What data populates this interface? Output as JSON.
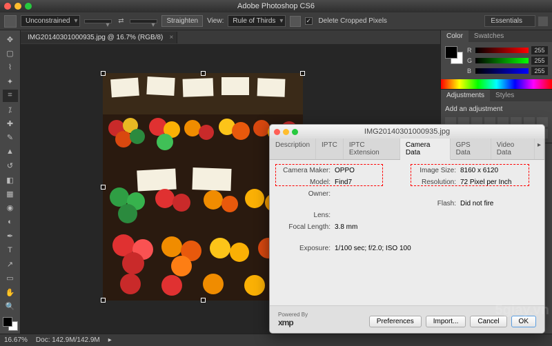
{
  "app_title": "Adobe Photoshop CS6",
  "workspace": "Essentials",
  "options_bar": {
    "ratio_mode": "Unconstrained",
    "straighten": "Straighten",
    "view_label": "View:",
    "overlay": "Rule of Thirds",
    "delete_cropped": "Delete Cropped Pixels"
  },
  "document": {
    "tab": "IMG20140301000935.jpg @ 16.7% (RGB/8)"
  },
  "panels": {
    "color_tab": "Color",
    "swatches_tab": "Swatches",
    "r": "255",
    "g": "255",
    "b": "255",
    "adjustments_tab": "Adjustments",
    "styles_tab": "Styles",
    "add_adjustment": "Add an adjustment"
  },
  "status": {
    "zoom": "16.67%",
    "doc": "Doc: 142.9M/142.9M"
  },
  "dialog": {
    "title": "IMG20140301000935.jpg",
    "tabs": {
      "description": "Description",
      "iptc": "IPTC",
      "iptc_ext": "IPTC Extension",
      "camera": "Camera Data",
      "gps": "GPS Data",
      "video": "Video Data"
    },
    "fields": {
      "camera_maker_k": "Camera Maker:",
      "camera_maker_v": "OPPO",
      "model_k": "Model:",
      "model_v": "Find7",
      "owner_k": "Owner:",
      "lens_k": "Lens:",
      "focal_k": "Focal Length:",
      "focal_v": "3.8 mm",
      "exposure_k": "Exposure:",
      "exposure_v": "1/100 sec;  f/2.0;  ISO 100",
      "image_size_k": "Image Size:",
      "image_size_v": "8160 x 6120",
      "resolution_k": "Resolution:",
      "resolution_v": "72 Pixel per Inch",
      "flash_k": "Flash:",
      "flash_v": "Did not fire"
    },
    "footer": {
      "powered": "Powered By",
      "xmp": "xmp",
      "preferences": "Preferences",
      "import": "Import...",
      "cancel": "Cancel",
      "ok": "OK"
    }
  },
  "watermark": "5giay.vn"
}
